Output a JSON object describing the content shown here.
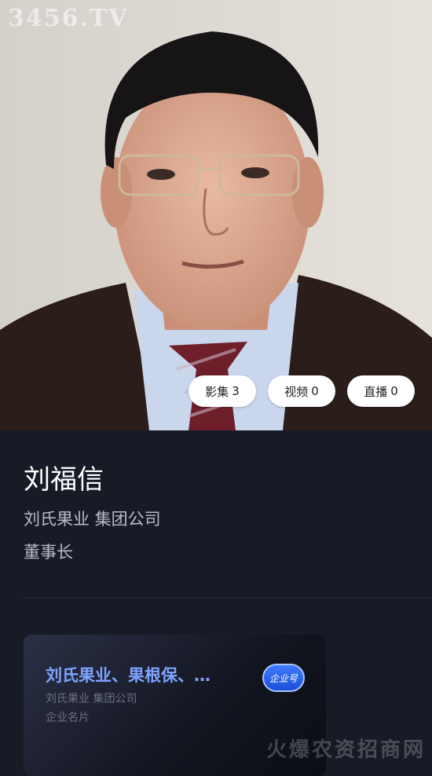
{
  "hero": {
    "watermark": "3456.TV",
    "chips": [
      {
        "label": "影集",
        "count": "3"
      },
      {
        "label": "视频",
        "count": "0"
      },
      {
        "label": "直播",
        "count": "0"
      }
    ]
  },
  "profile": {
    "name": "刘福信",
    "company": "刘氏果业 集团公司",
    "title": "董事长"
  },
  "card": {
    "title": "刘氏果业、果根保、…",
    "company": "刘氏果业 集团公司",
    "type": "企业名片",
    "badge": "企业号"
  },
  "footer_watermark": "火爆农资招商网",
  "colors": {
    "background": "#161b26",
    "card_title": "#7ea3ff",
    "badge": "#2f6bff"
  }
}
